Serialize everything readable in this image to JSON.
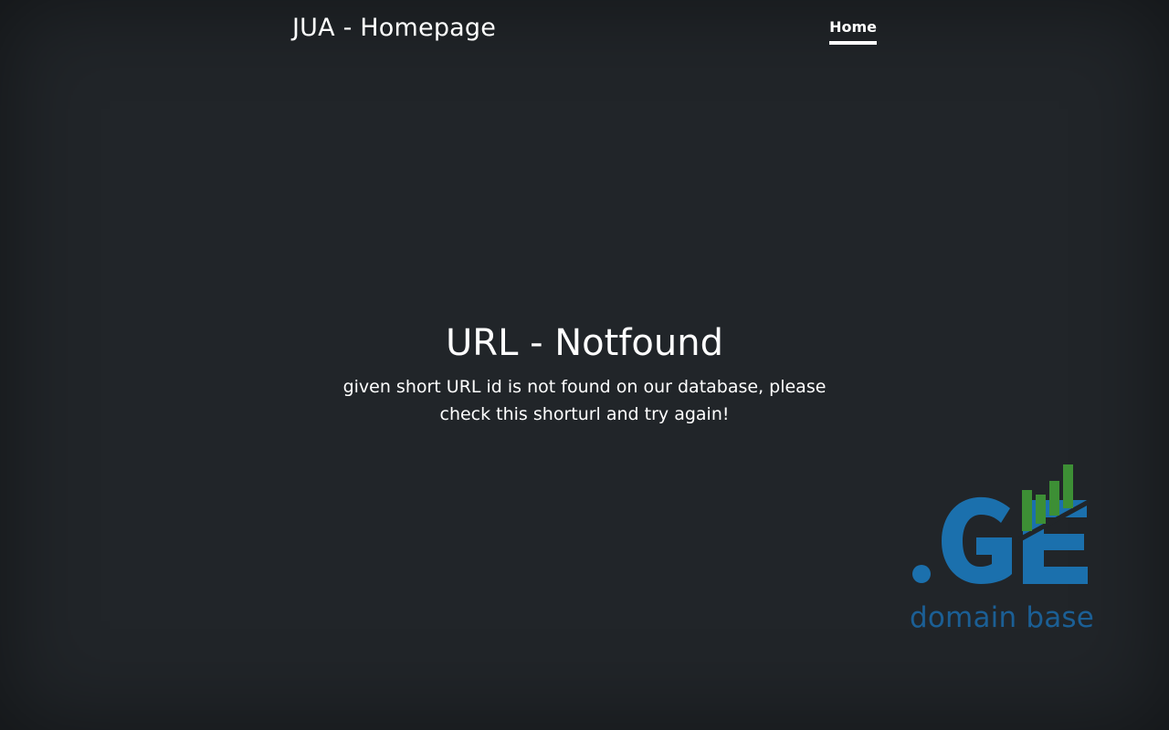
{
  "header": {
    "brand": "JUA - Homepage",
    "nav": [
      {
        "label": "Home",
        "active": true
      }
    ]
  },
  "main": {
    "heading": "URL - Notfound",
    "message": "given short URL id is not found on our database, please check this shorturl and try again!"
  },
  "logo": {
    "mark": ".GE",
    "tagline": "domain base",
    "colors": {
      "blue": "#1b70ad",
      "green": "#3d8f35",
      "tagline": "#1b5f95"
    }
  },
  "colors": {
    "background": "#212529",
    "text": "#ffffff"
  }
}
